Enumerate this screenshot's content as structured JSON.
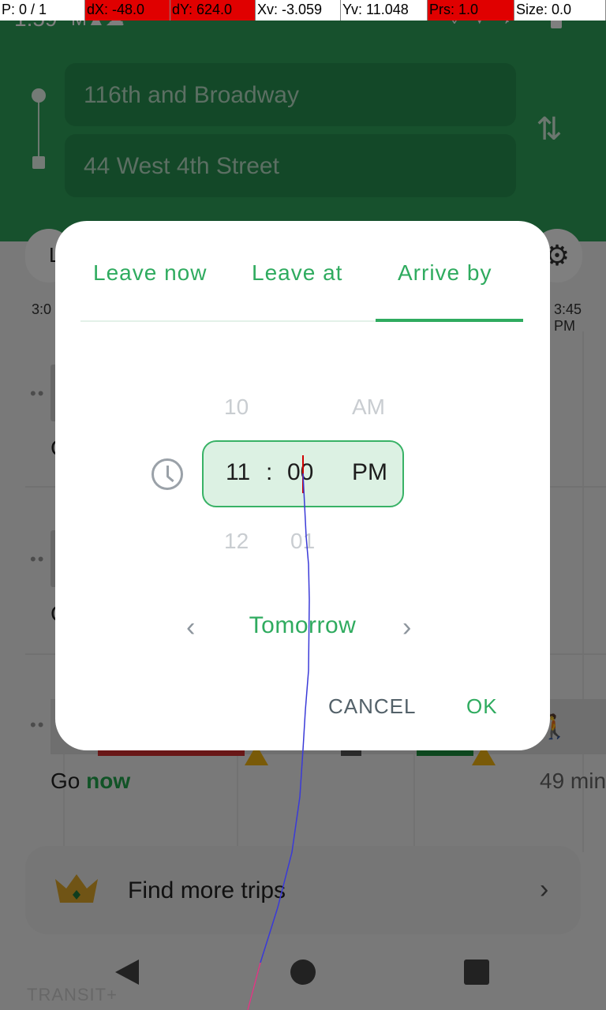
{
  "status_bar": {
    "time": "1:59",
    "left_icons": "M▲☁"
  },
  "debug_bar": {
    "p": "P: 0 / 1",
    "dx": "dX: -48.0",
    "dy": "dY: 624.0",
    "xv": "Xv: -3.059",
    "yv": "Yv: 11.048",
    "prs": "Prs: 1.0",
    "size": "Size: 0.0",
    "highlight_color": "#e00000"
  },
  "header": {
    "from": "116th and Broadway",
    "to": "44 West 4th Street",
    "swap_icon": "swap-vertical-icon",
    "background": "#2fa35a"
  },
  "background": {
    "left_pill_text": "L",
    "time_left": "3:0",
    "time_right": "3:45 PM",
    "row_dots": "••",
    "row_initial": "C",
    "go_prefix": "Go ",
    "go_now": "now",
    "duration": "49 min",
    "find_more": "Find more trips",
    "brand": "TRANSIT+"
  },
  "dialog": {
    "tabs": [
      {
        "label": "Leave now"
      },
      {
        "label": "Leave at"
      },
      {
        "label": "Arrive by",
        "selected": true
      }
    ],
    "picker": {
      "hour_prev": "10",
      "hour": "11",
      "hour_next": "12",
      "separator": ":",
      "minute": "00",
      "minute_next": "01",
      "period_prev": "AM",
      "period": "PM"
    },
    "day": {
      "prev_glyph": "‹",
      "label": "Tomorrow",
      "next_glyph": "›"
    },
    "buttons": {
      "cancel": "CANCEL",
      "ok": "OK"
    },
    "accent": "#2fab5f"
  }
}
